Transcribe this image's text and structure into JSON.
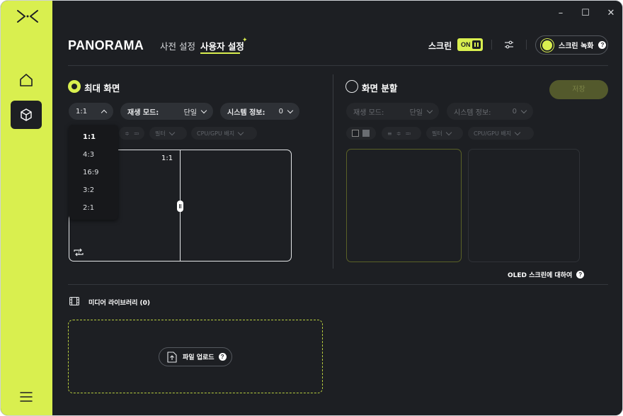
{
  "app": {
    "brand": "PANORAMA",
    "accent": "#d9ef4f",
    "background": "#1d1f23"
  },
  "sidebar": {
    "items": [
      {
        "icon": "logo-icon"
      },
      {
        "icon": "home-icon"
      },
      {
        "icon": "box-icon",
        "active": true
      },
      {
        "icon": "menu-icon"
      }
    ]
  },
  "window_controls": {
    "minimize": "–",
    "maximize": "☐",
    "close": "✕"
  },
  "header": {
    "tabs": [
      {
        "label": "사전 설정",
        "active": false
      },
      {
        "label": "사용자 설정",
        "active": true
      }
    ],
    "screen_label": "스크린",
    "toggle_label": "ON",
    "record_label": "스크린 녹화",
    "help": "?"
  },
  "left_panel": {
    "title": "최대 화면",
    "ratio_value": "1:1",
    "play_mode_label": "재생 모드:",
    "play_mode_value": "단일",
    "system_info_label": "시스템 정보:",
    "system_info_value": "0",
    "filter_label": "필터",
    "cpu_label": "CPU/GPU 배지",
    "ratio_options": [
      "1:1",
      "4:3",
      "16:9",
      "3:2",
      "2:1"
    ],
    "selected_ratio": "1:1",
    "preview_label": "1:1"
  },
  "right_panel": {
    "title": "화면 분할",
    "save_label": "저장",
    "play_mode_label": "재생 모드:",
    "play_mode_value": "단일",
    "system_info_label": "시스템 정보:",
    "system_info_value": "0",
    "filter_label": "필터",
    "cpu_label": "CPU/GPU 배지",
    "oled_label": "OLED 스크린에 대하여"
  },
  "media": {
    "title": "미디어 라이브러리 (0)",
    "upload_label": "파일 업로드"
  }
}
